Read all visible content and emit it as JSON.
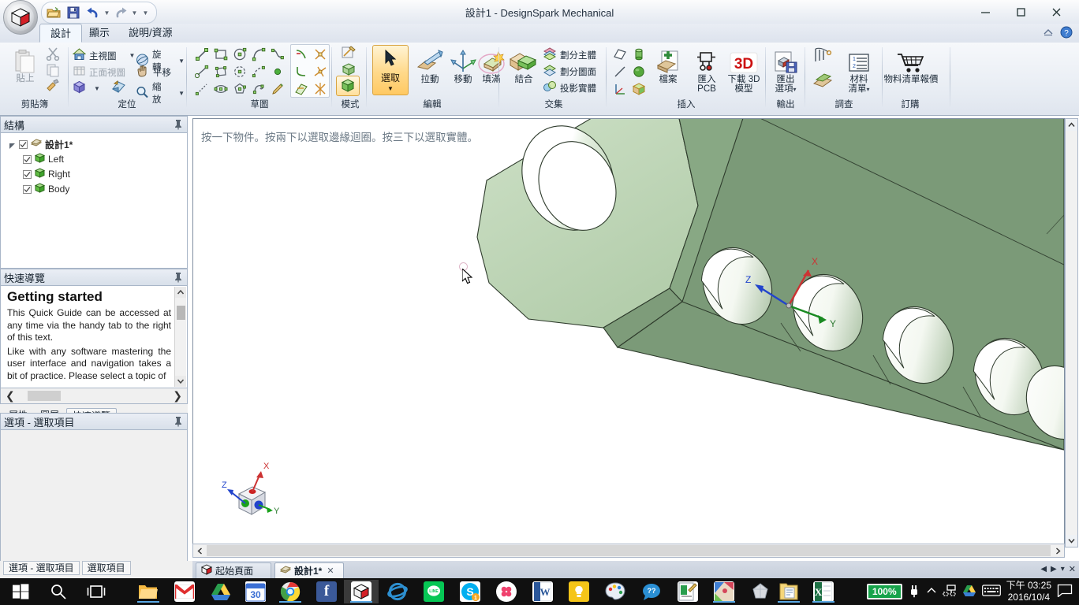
{
  "window": {
    "title": "設計1 - DesignSpark Mechanical",
    "minimize": "–",
    "maximize": "□",
    "close": "✕"
  },
  "quick_access": {
    "open_label": "open-folder",
    "save_label": "save",
    "undo_label": "undo",
    "redo_label": "redo",
    "more_label": "▾"
  },
  "tabs": [
    {
      "label": "設計",
      "active": true
    },
    {
      "label": "顯示",
      "active": false
    },
    {
      "label": "說明/資源",
      "active": false
    }
  ],
  "ribbon": {
    "groups": [
      {
        "name": "clipboard",
        "label": "剪貼簿",
        "paste_label": "貼上",
        "cut_label": "剪下",
        "copy_label": "複製",
        "format_label": "複製格式"
      },
      {
        "name": "orient",
        "label": "定位",
        "items": [
          {
            "label": "主視圖",
            "caret": "▾"
          },
          {
            "label": "旋轉",
            "caret": "▾"
          },
          {
            "label": "正面視圖",
            "caret": ""
          },
          {
            "label": "平移",
            "caret": ""
          },
          {
            "label": "縮放",
            "caret": "▾"
          }
        ],
        "view_caret": "▾"
      },
      {
        "name": "sketch",
        "label": "草圖"
      },
      {
        "name": "mode",
        "label": "模式"
      },
      {
        "name": "edit",
        "label": "編輯",
        "items": [
          {
            "label": "選取",
            "caret": "▾"
          },
          {
            "label": "拉動",
            "caret": ""
          },
          {
            "label": "移動",
            "caret": ""
          },
          {
            "label": "填滿",
            "caret": ""
          }
        ]
      },
      {
        "name": "intersect",
        "label": "交集",
        "combine_label": "結合",
        "items": [
          {
            "label": "劃分主體"
          },
          {
            "label": "劃分圖面"
          },
          {
            "label": "投影實體"
          }
        ]
      },
      {
        "name": "insert",
        "label": "插入",
        "file_label": "檔案",
        "pcb_label": "匯入\nPCB",
        "pcb_line1": "匯入",
        "pcb_line2": "PCB",
        "model_line1": "下載 3D",
        "model_line2": "模型",
        "model_badge": "3D"
      },
      {
        "name": "output",
        "label": "輸出",
        "export_line1": "匯出",
        "export_line2": "選項",
        "caret": "▾"
      },
      {
        "name": "survey",
        "label": "調查",
        "material_line1": "材料",
        "material_line2": "清單",
        "caret": "▾"
      },
      {
        "name": "order",
        "label": "訂購",
        "quote_label": "物料清單報價"
      }
    ],
    "help_icons": [
      "collapse-ribbon-icon",
      "help-icon"
    ]
  },
  "structure_panel": {
    "title": "結構",
    "pin": "pin-icon",
    "tree": [
      {
        "label": "設計1*",
        "level": 0,
        "bold": true,
        "checked": true,
        "icon": "design-icon",
        "expander": "◢"
      },
      {
        "label": "Left",
        "level": 1,
        "bold": false,
        "checked": true,
        "icon": "body-icon"
      },
      {
        "label": "Right",
        "level": 1,
        "bold": false,
        "checked": true,
        "icon": "body-icon"
      },
      {
        "label": "Body",
        "level": 1,
        "bold": false,
        "checked": true,
        "icon": "body-icon"
      }
    ]
  },
  "quick_guide": {
    "title": "快速導覽",
    "pin": "pin-icon",
    "heading": "Getting started",
    "paragraphs": [
      "This Quick Guide can be accessed at any time via the handy tab to the right of this text.",
      "Like with any software mastering the user interface and navigation takes a bit of practice. Please select a topic of"
    ],
    "prev": "❮",
    "next": "❯",
    "tabs": [
      {
        "label": "屬性",
        "selected": false
      },
      {
        "label": "圖層",
        "selected": false
      },
      {
        "label": "快速導覽",
        "selected": true
      }
    ]
  },
  "options_panel": {
    "title": "選項 - 選取項目",
    "pin": "pin-icon"
  },
  "status_tabs": [
    {
      "label": "選項 - 選取項目"
    },
    {
      "label": "選取項目"
    }
  ],
  "viewport": {
    "hint": "按一下物件。按兩下以選取邊緣迴圈。按三下以選取實體。",
    "axes": {
      "x": "X",
      "y": "Y",
      "z": "Z"
    },
    "cursor": "arrow-cursor",
    "model_color_light": "#c5dcc0",
    "model_color_mid": "#a8c3a1",
    "model_color_dark": "#7b9a78",
    "background": "#ffffff"
  },
  "document_tabs": [
    {
      "label": "起始頁面",
      "selected": false,
      "icon": "home-cube-icon",
      "closable": false
    },
    {
      "label": "設計1*",
      "selected": true,
      "icon": "design-icon",
      "closable": true,
      "close": "✕"
    }
  ],
  "doc_nav": [
    "◀",
    "▶",
    "▾",
    "✕"
  ],
  "taskbar": {
    "start": "windows-logo",
    "items": [
      {
        "name": "search-icon",
        "label": ""
      },
      {
        "name": "task-view-icon",
        "label": ""
      },
      {
        "name": "file-explorer-icon",
        "label": ""
      },
      {
        "name": "gmail-icon",
        "label": "M"
      },
      {
        "name": "google-drive-icon",
        "label": ""
      },
      {
        "name": "google-calendar-icon",
        "label": "30"
      },
      {
        "name": "google-chrome-icon",
        "label": ""
      },
      {
        "name": "facebook-icon",
        "label": "f"
      },
      {
        "name": "designspark-mechanical-icon",
        "label": ""
      },
      {
        "name": "internet-explorer-icon",
        "label": "e"
      },
      {
        "name": "line-icon",
        "label": "LINE"
      },
      {
        "name": "skype-icon",
        "label": "S"
      },
      {
        "name": "flickr-icon",
        "label": ""
      },
      {
        "name": "microsoft-word-icon",
        "label": "W"
      },
      {
        "name": "sticky-notes-icon",
        "label": ""
      },
      {
        "name": "paint-icon",
        "label": ""
      },
      {
        "name": "plurk-icon",
        "label": ""
      },
      {
        "name": "photo-editor-icon",
        "label": ""
      },
      {
        "name": "photos-icon",
        "label": ""
      },
      {
        "name": "sketch-app-icon",
        "label": ""
      },
      {
        "name": "notepad-icon",
        "label": ""
      },
      {
        "name": "microsoft-excel-icon",
        "label": "X"
      }
    ],
    "tray": {
      "battery": "100%",
      "icons": [
        "power-plug-icon",
        "show-hidden-icon",
        "network-icon",
        "google-drive-tray-icon",
        "keyboard-icon"
      ],
      "time": "下午 03:25",
      "date": "2016/10/4",
      "action_center": "notification-icon"
    }
  }
}
